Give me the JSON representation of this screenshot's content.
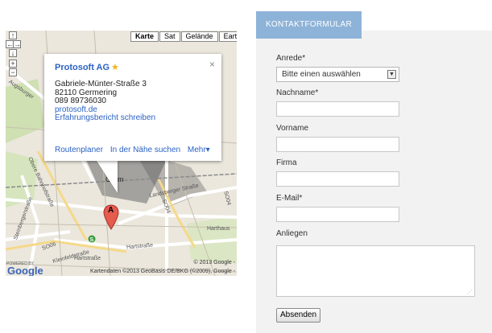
{
  "map": {
    "zoom_controls": [
      "↑",
      "←",
      "→",
      "↓",
      "+",
      "−"
    ],
    "map_types": [
      "Karte",
      "Sat",
      "Gelände",
      "Earth"
    ],
    "active_map_type": "Karte",
    "info_window": {
      "title": "Protosoft AG",
      "street": "Gabriele-Münter-Straße 3",
      "city": "82110 Germering",
      "phone": "089 89736030",
      "website": "protosoft.de",
      "review_link": "Erfahrungsbericht schreiben",
      "actions": [
        "Routenplaner",
        "In der Nähe suchen",
        "Mehr▾"
      ],
      "close": "×"
    },
    "marker_label": "A",
    "street_labels": [
      "Augsburger",
      "Obere Bahnhofstraße",
      "Steinbergerstraße",
      "Landsberger Straße",
      "Hartstraße",
      "Hartstraße",
      "SO04",
      "SO06",
      "Harthaus",
      "Germ",
      "Kleinfeldstraße",
      "SO04"
    ],
    "copyright_line1": "© 2013 Google -",
    "copyright_line2": "Kartendaten ©2013 GeoBasis-DE/BKG (©2009), Google -",
    "powered_by": "POWERED BY",
    "google_logo": "Google"
  },
  "form": {
    "tab_label": "KONTAKTFORMULAR",
    "anrede_label": "Anrede*",
    "anrede_selected": "Bitte einen auswählen",
    "nachname_label": "Nachname*",
    "vorname_label": "Vorname",
    "firma_label": "Firma",
    "email_label": "E-Mail*",
    "anliegen_label": "Anliegen",
    "submit_label": "Absenden"
  },
  "colors": {
    "tab_bg": "#8eb3d8",
    "link": "#2a62c4",
    "form_bg": "#f2f2f2"
  }
}
